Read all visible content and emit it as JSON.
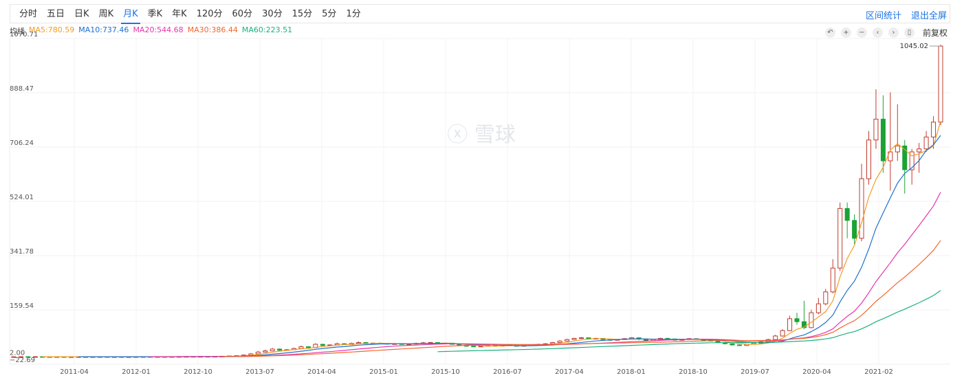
{
  "tabs": [
    {
      "label": "分时",
      "active": false
    },
    {
      "label": "五日",
      "active": false
    },
    {
      "label": "日K",
      "active": false
    },
    {
      "label": "周K",
      "active": false
    },
    {
      "label": "月K",
      "active": true
    },
    {
      "label": "季K",
      "active": false
    },
    {
      "label": "年K",
      "active": false
    },
    {
      "label": "120分",
      "active": false
    },
    {
      "label": "60分",
      "active": false
    },
    {
      "label": "30分",
      "active": false
    },
    {
      "label": "15分",
      "active": false
    },
    {
      "label": "5分",
      "active": false
    },
    {
      "label": "1分",
      "active": false
    }
  ],
  "right_links": {
    "interval_stats": "区间统计",
    "exit_fullscreen": "退出全屏"
  },
  "ma_header": {
    "label": "均线",
    "items": [
      {
        "text": "MA5:780.59",
        "color": "#f59a23"
      },
      {
        "text": "MA10:737.46",
        "color": "#1e6fd0"
      },
      {
        "text": "MA20:544.68",
        "color": "#e535ab"
      },
      {
        "text": "MA30:386.44",
        "color": "#f2662d"
      },
      {
        "text": "MA60:223.51",
        "color": "#18b27a"
      }
    ]
  },
  "tools": {
    "icons": [
      "undo-icon",
      "zoom-in-icon",
      "zoom-out-icon",
      "prev-icon",
      "next-icon",
      "reset-icon"
    ],
    "adjust_label": "前复权"
  },
  "watermark": "雪球",
  "chart_data": {
    "type": "candlestick",
    "ylim": [
      -22.69,
      1070.71
    ],
    "yticks": [
      1070.71,
      888.47,
      706.24,
      524.01,
      341.78,
      159.54,
      2.0,
      -22.69
    ],
    "ytick_labels": [
      "1070.71",
      "888.47",
      "706.24",
      "524.01",
      "341.78",
      "159.54",
      "2.00",
      "−22.69"
    ],
    "xtick_labels": [
      "2011-04",
      "2012-01",
      "2012-10",
      "2013-07",
      "2014-04",
      "2015-01",
      "2015-10",
      "2016-07",
      "2017-04",
      "2018-01",
      "2018-10",
      "2019-07",
      "2020-04",
      "2021-02"
    ],
    "max_label": "1045.02",
    "colors": {
      "up": "#c0392b",
      "down": "#1aa235"
    },
    "candles": [
      [
        2,
        2.3,
        3,
        1.5
      ],
      [
        2.3,
        2.5,
        3,
        2
      ],
      [
        2.5,
        2.2,
        3,
        2
      ],
      [
        2.2,
        2.6,
        3,
        2
      ],
      [
        2.6,
        2.4,
        3,
        2
      ],
      [
        2.4,
        2.3,
        3,
        2
      ],
      [
        2.3,
        2.5,
        3,
        2
      ],
      [
        2.5,
        2.1,
        3,
        2
      ],
      [
        2.1,
        2.2,
        2.5,
        1.8
      ],
      [
        2.2,
        2.4,
        3,
        2
      ],
      [
        2.4,
        2.3,
        3,
        2
      ],
      [
        2.3,
        2.5,
        3,
        2
      ],
      [
        2.5,
        2.6,
        3,
        2
      ],
      [
        2.6,
        2.4,
        3,
        2
      ],
      [
        2.4,
        2.5,
        3,
        2
      ],
      [
        2.5,
        2.3,
        3,
        2
      ],
      [
        2.3,
        2.4,
        3,
        2
      ],
      [
        2.4,
        2.6,
        3,
        2
      ],
      [
        2.6,
        2.8,
        3,
        2
      ],
      [
        2.8,
        2.5,
        3,
        2
      ],
      [
        2.5,
        2.7,
        3,
        2
      ],
      [
        2.7,
        2.6,
        3,
        2
      ],
      [
        2.6,
        2.8,
        3,
        2
      ],
      [
        2.8,
        3,
        3.5,
        2.5
      ],
      [
        3,
        3.2,
        3.5,
        2.8
      ],
      [
        3.2,
        3.1,
        3.5,
        3
      ],
      [
        3.1,
        3.3,
        3.5,
        3
      ],
      [
        3.3,
        3.2,
        3.5,
        3
      ],
      [
        3.2,
        3.5,
        4,
        3
      ],
      [
        3.5,
        4,
        5,
        3
      ],
      [
        4,
        5,
        6,
        4
      ],
      [
        5,
        6,
        7,
        5
      ],
      [
        6,
        8,
        10,
        6
      ],
      [
        8,
        12,
        15,
        8
      ],
      [
        12,
        18,
        22,
        11
      ],
      [
        18,
        22,
        26,
        17
      ],
      [
        22,
        28,
        32,
        21
      ],
      [
        28,
        24,
        30,
        20
      ],
      [
        24,
        26,
        28,
        22
      ],
      [
        26,
        30,
        33,
        25
      ],
      [
        30,
        36,
        40,
        29
      ],
      [
        36,
        33,
        38,
        31
      ],
      [
        33,
        44,
        48,
        32
      ],
      [
        44,
        40,
        46,
        38
      ],
      [
        40,
        42,
        44,
        39
      ],
      [
        42,
        46,
        50,
        41
      ],
      [
        46,
        43,
        48,
        42
      ],
      [
        43,
        47,
        50,
        42
      ],
      [
        47,
        50,
        54,
        46
      ],
      [
        50,
        46,
        52,
        44
      ],
      [
        46,
        48,
        50,
        45
      ],
      [
        48,
        47,
        50,
        46
      ],
      [
        47,
        45,
        48,
        44
      ],
      [
        45,
        46,
        48,
        44
      ],
      [
        46,
        44,
        47,
        43
      ],
      [
        44,
        45,
        47,
        43
      ],
      [
        45,
        47,
        50,
        44
      ],
      [
        47,
        49,
        52,
        46
      ],
      [
        49,
        50,
        52,
        48
      ],
      [
        50,
        46,
        51,
        45
      ],
      [
        46,
        48,
        50,
        45
      ],
      [
        48,
        44,
        49,
        43
      ],
      [
        44,
        40,
        45,
        38
      ],
      [
        40,
        38,
        42,
        36
      ],
      [
        38,
        36,
        40,
        35
      ],
      [
        36,
        38,
        40,
        35
      ],
      [
        38,
        40,
        42,
        37
      ],
      [
        40,
        38,
        41,
        37
      ],
      [
        38,
        42,
        44,
        37
      ],
      [
        42,
        40,
        43,
        39
      ],
      [
        40,
        38,
        41,
        37
      ],
      [
        38,
        40,
        42,
        37
      ],
      [
        40,
        42,
        44,
        39
      ],
      [
        42,
        44,
        46,
        41
      ],
      [
        44,
        46,
        48,
        43
      ],
      [
        46,
        50,
        52,
        45
      ],
      [
        50,
        55,
        58,
        49
      ],
      [
        55,
        60,
        63,
        54
      ],
      [
        60,
        64,
        66,
        58
      ],
      [
        64,
        66,
        68,
        62
      ],
      [
        66,
        62,
        67,
        60
      ],
      [
        62,
        64,
        66,
        61
      ],
      [
        64,
        60,
        65,
        58
      ],
      [
        60,
        58,
        62,
        56
      ],
      [
        58,
        60,
        62,
        57
      ],
      [
        60,
        63,
        65,
        59
      ],
      [
        63,
        66,
        68,
        62
      ],
      [
        66,
        62,
        67,
        58
      ],
      [
        62,
        56,
        63,
        54
      ],
      [
        56,
        60,
        62,
        55
      ],
      [
        60,
        64,
        66,
        59
      ],
      [
        64,
        62,
        66,
        60
      ],
      [
        62,
        58,
        63,
        56
      ],
      [
        58,
        60,
        62,
        57
      ],
      [
        60,
        63,
        65,
        59
      ],
      [
        63,
        61,
        64,
        60
      ],
      [
        61,
        58,
        62,
        57
      ],
      [
        58,
        55,
        60,
        54
      ],
      [
        55,
        50,
        56,
        48
      ],
      [
        50,
        46,
        52,
        44
      ],
      [
        46,
        42,
        47,
        40
      ],
      [
        42,
        40,
        44,
        39
      ],
      [
        40,
        44,
        46,
        39
      ],
      [
        44,
        48,
        50,
        43
      ],
      [
        48,
        52,
        54,
        47
      ],
      [
        52,
        60,
        63,
        51
      ],
      [
        60,
        72,
        76,
        58
      ],
      [
        72,
        90,
        95,
        70
      ],
      [
        90,
        130,
        140,
        88
      ],
      [
        130,
        120,
        150,
        110
      ],
      [
        120,
        100,
        190,
        95
      ],
      [
        100,
        150,
        160,
        98
      ],
      [
        150,
        180,
        200,
        145
      ],
      [
        180,
        220,
        230,
        175
      ],
      [
        220,
        300,
        330,
        215
      ],
      [
        300,
        500,
        520,
        290
      ],
      [
        500,
        460,
        520,
        400
      ],
      [
        460,
        400,
        480,
        380
      ],
      [
        400,
        600,
        650,
        390
      ],
      [
        600,
        730,
        760,
        580
      ],
      [
        730,
        800,
        900,
        700
      ],
      [
        800,
        660,
        880,
        620
      ],
      [
        660,
        690,
        890,
        560
      ],
      [
        690,
        710,
        850,
        660
      ],
      [
        710,
        630,
        730,
        550
      ],
      [
        630,
        690,
        700,
        580
      ],
      [
        690,
        700,
        720,
        620
      ],
      [
        700,
        740,
        760,
        690
      ],
      [
        740,
        790,
        810,
        700
      ],
      [
        790,
        1045.02,
        1050,
        780
      ]
    ],
    "ma": {
      "MA5": {
        "start": 4,
        "end": 780.59
      },
      "MA10": {
        "start": 9,
        "end": 737.46
      },
      "MA20": {
        "start": 19,
        "end": 544.68
      },
      "MA30": {
        "start": 29,
        "end": 386.44
      },
      "MA60": {
        "start": 59,
        "end": 223.51
      }
    }
  }
}
